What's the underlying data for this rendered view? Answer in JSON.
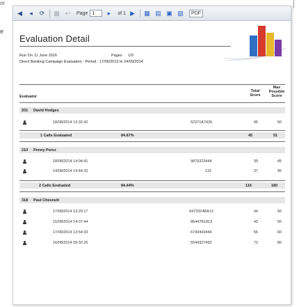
{
  "toolbar": {
    "page_label": "Page",
    "page_value": "1",
    "page_of": "of 1",
    "format_value": "PDF"
  },
  "page_edges": {
    "top_left": "or",
    "left_fragment": "e"
  },
  "report": {
    "title": "Evaluation Detail",
    "run_on_label": "Run On",
    "run_on_value": "11 June 2016",
    "pages_label": "Pages",
    "pages_value": "1/9",
    "criteria": "Direct Banking Campaign Evaluation - Period : 17/09/2013 to 24/09/2014",
    "columns": {
      "evaluator": "Evaluator",
      "total_score": "Total Score",
      "max_score": "Max Possible Score"
    },
    "groups": [
      {
        "id": "201",
        "name": "David Hodges",
        "rows": [
          {
            "date": "18/08/2014 13:32:42",
            "ref": "52371A7426",
            "score": "45",
            "max": "50"
          }
        ],
        "summary_label": "1 Calls Evaluated",
        "summary_pct": "84.87%",
        "summary_total": "45",
        "summary_max": "51"
      },
      {
        "id": "210",
        "name": "Penny Perez",
        "rows": [
          {
            "date": "18/08/2014 14:04:41",
            "ref": "9879323444",
            "score": "39",
            "max": "45"
          },
          {
            "date": "14/08/2014 14:44:32",
            "ref": "131",
            "score": "37",
            "max": "45"
          }
        ],
        "summary_label": "2 Calls Evaluated",
        "summary_pct": "84.44%",
        "summary_total": "116",
        "summary_max": "180"
      },
      {
        "id": "318",
        "name": "Paul Chesnutt",
        "rows": [
          {
            "date": "17/08/2014 13:29:17",
            "ref": "6473324BA13",
            "score": "44",
            "max": "50"
          },
          {
            "date": "15/08/2014 14:07:44",
            "ref": "86447B1813",
            "score": "43",
            "max": "50"
          },
          {
            "date": "17/08/2014 13:54:33",
            "ref": "6743443444",
            "score": "56",
            "max": "60"
          },
          {
            "date": "16/08/2014 09:32:26",
            "ref": "5544327493",
            "score": "72",
            "max": "80"
          }
        ]
      }
    ]
  }
}
